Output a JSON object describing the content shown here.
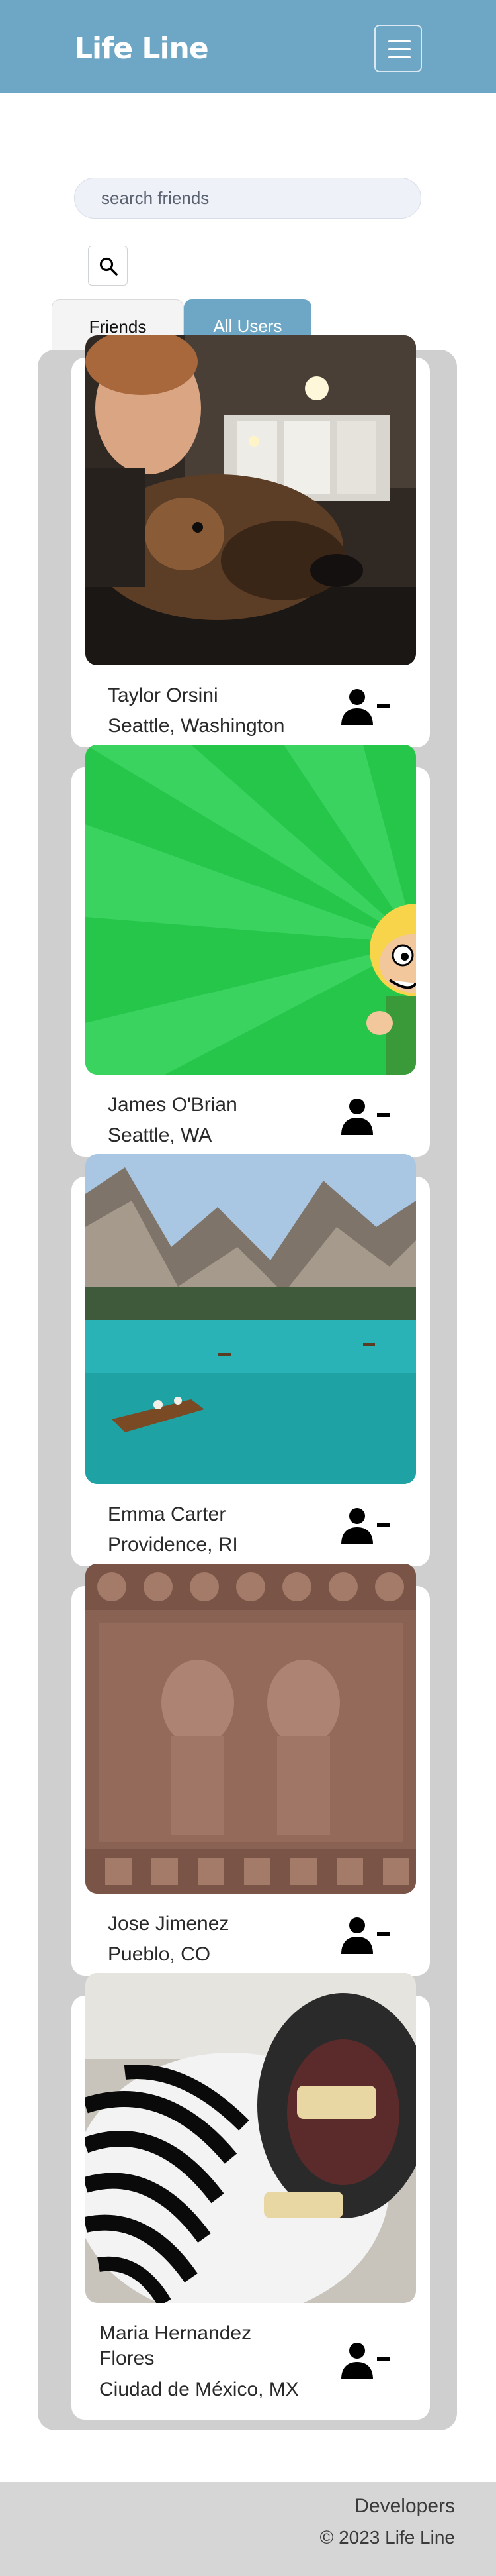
{
  "navbar": {
    "brand": "Life Line",
    "menu_icon": "hamburger-menu-icon"
  },
  "search": {
    "placeholder": "search friends",
    "value": "",
    "button_icon": "magnifier-icon"
  },
  "tabs": [
    {
      "label": "Friends",
      "active": false
    },
    {
      "label": "All Users",
      "active": true
    }
  ],
  "users": [
    {
      "name": "Taylor Orsini",
      "location": "Seattle, Washington",
      "photo": "man-with-dog-photo",
      "action_icon": "remove-user-icon"
    },
    {
      "name": "James O'Brian",
      "location": "Seattle, WA",
      "photo": "cartoon-character-photo",
      "action_icon": "remove-user-icon"
    },
    {
      "name": "Emma Carter",
      "location": "Providence, RI",
      "photo": "mountain-lake-photo",
      "action_icon": "remove-user-icon"
    },
    {
      "name": "Jose Jimenez",
      "location": "Pueblo, CO",
      "photo": "stone-carving-photo",
      "action_icon": "remove-user-icon"
    },
    {
      "name": "Maria Hernandez Flores",
      "location": "Ciudad de México, MX",
      "photo": "zebra-photo",
      "action_icon": "remove-user-icon"
    }
  ],
  "footer": {
    "developers": "Developers",
    "copyright": "© 2023 Life Line"
  },
  "colors": {
    "navbar": "#6ea7c5",
    "active_tab": "#6ea7c5",
    "panel": "#cfcfcf",
    "footer": "#d6d6d6"
  }
}
